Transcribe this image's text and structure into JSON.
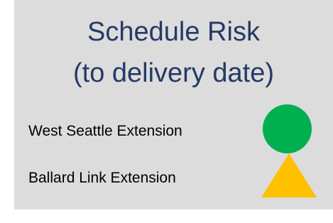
{
  "title": {
    "line1": "Schedule Risk",
    "line2": "(to delivery date)"
  },
  "items": [
    {
      "label": "West Seattle Extension",
      "status_icon": "green-circle-icon",
      "color": "#00b050"
    },
    {
      "label": "Ballard Link Extension",
      "status_icon": "yellow-triangle-icon",
      "color": "#ffc000"
    }
  ],
  "colors": {
    "panel_background": "#dcdcdc",
    "title_text": "#243a67"
  }
}
